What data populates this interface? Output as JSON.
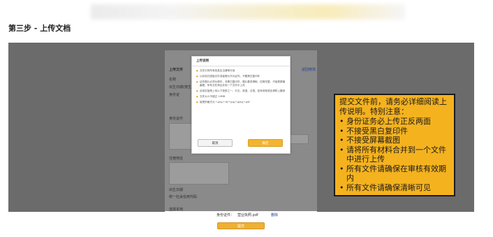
{
  "heading": {
    "step_title": "第三步 - 上传文档"
  },
  "form": {
    "section_title": "上传文件",
    "top_right_link": "返回修改",
    "fields": [
      {
        "label": "名称"
      },
      {
        "label": "出生日期(按生日)"
      },
      {
        "label": "身份证"
      },
      {
        "label": "身份证件"
      },
      {
        "label": "住宿地址"
      },
      {
        "label": "出生日期"
      },
      {
        "label": "统一社会信用代码"
      },
      {
        "label": "选择本地"
      }
    ],
    "uploaded_file": {
      "label": "身份证件：",
      "file_name": "营业执照.pdf",
      "delete_link": "删除"
    },
    "submit_label": "提交"
  },
  "modal": {
    "title": "上传说明",
    "items": [
      "文件中的所有信息应当清晰可读",
      "以彩色扫描版文件或者照片作为证件。不要黑白复印件",
      "证件图片必须为原件，非黑白复印件，图片要求清晰，四角完整，不接受屏幕截图，所有文件请合并到一个文件中上传",
      "目前仅接受上传以下类型之一：中文、英语、法语，如有其他语言请附上翻译",
      "文件大小不超过 10MB",
      "接受的格式为 *.png,*.tif,*.jpg,*.jpeg,*.pdf"
    ],
    "cancel_label": "取消",
    "confirm_label": "确定"
  },
  "callout": {
    "intro": "提交文件前，请务必详细阅读上传说明。特别注意：",
    "points": [
      "身份证务必上传正反两面",
      "不接受黑白复印件",
      "不接受屏幕截图",
      "请将所有材料合并到一个文件中进行上传",
      "所有文件请确保在审核有效期内",
      "所有文件请确保清晰可见"
    ]
  },
  "colors": {
    "overlay": "#6b6b6b",
    "accent": "#f5b21f",
    "button": "#f0b030"
  }
}
